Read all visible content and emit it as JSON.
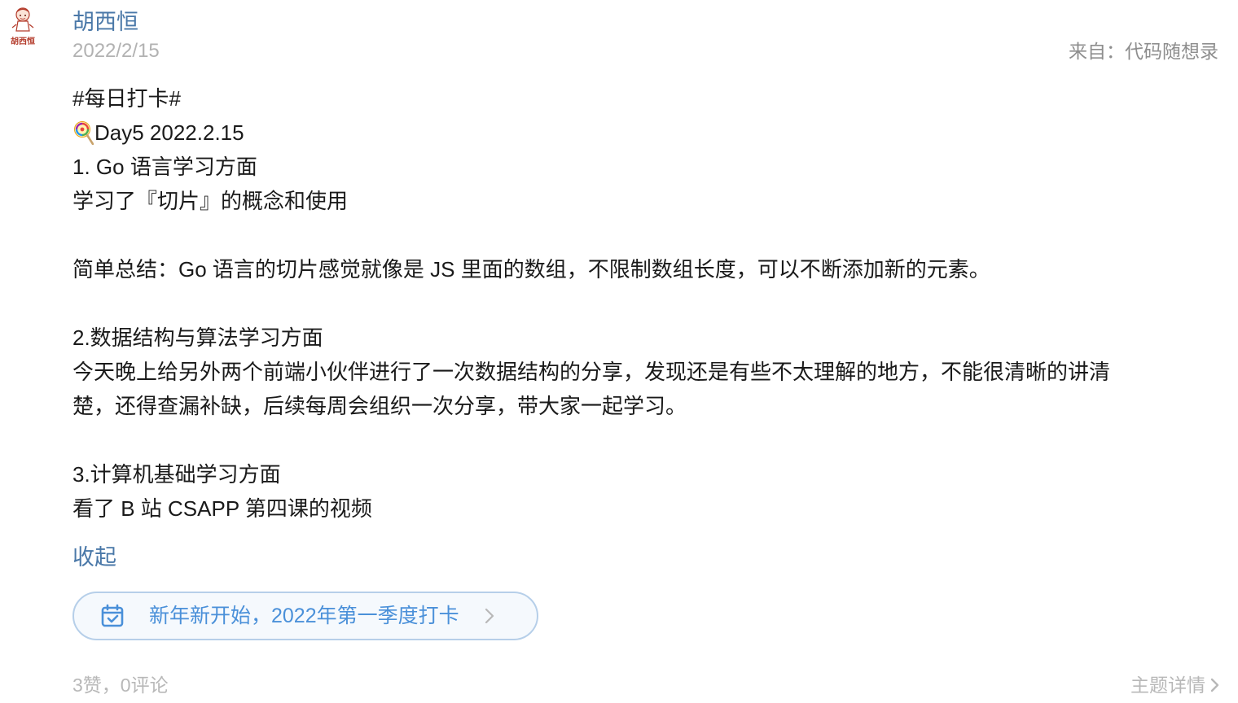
{
  "post": {
    "author": "胡西恒",
    "avatar_text": "胡西恒",
    "date": "2022/2/15",
    "source": "来自：代码随想录",
    "lines": [
      "#每日打卡#",
      "Day5 2022.2.15",
      "1. Go 语言学习方面",
      "学习了『切片』的概念和使用",
      "",
      "简单总结：Go 语言的切片感觉就像是 JS 里面的数组，不限制数组长度，可以不断添加新的元素。",
      "",
      "2.数据结构与算法学习方面",
      "今天晚上给另外两个前端小伙伴进行了一次数据结构的分享，发现还是有些不太理解的地方，不能很清晰的讲清",
      "楚，还得查漏补缺，后续每周会组织一次分享，带大家一起学习。",
      "",
      "3.计算机基础学习方面",
      "看了 B 站 CSAPP 第四课的视频"
    ],
    "collapse_label": "收起",
    "topic": {
      "label": "新年新开始，2022年第一季度打卡",
      "icon": "calendar-check-icon"
    },
    "stats": "3赞，0评论",
    "detail_label": "主题详情"
  },
  "colors": {
    "link_blue": "#4a78a8",
    "topic_blue": "#4a90d9",
    "topic_border": "#b6cfe9",
    "muted_gray": "#b8b8b8"
  }
}
